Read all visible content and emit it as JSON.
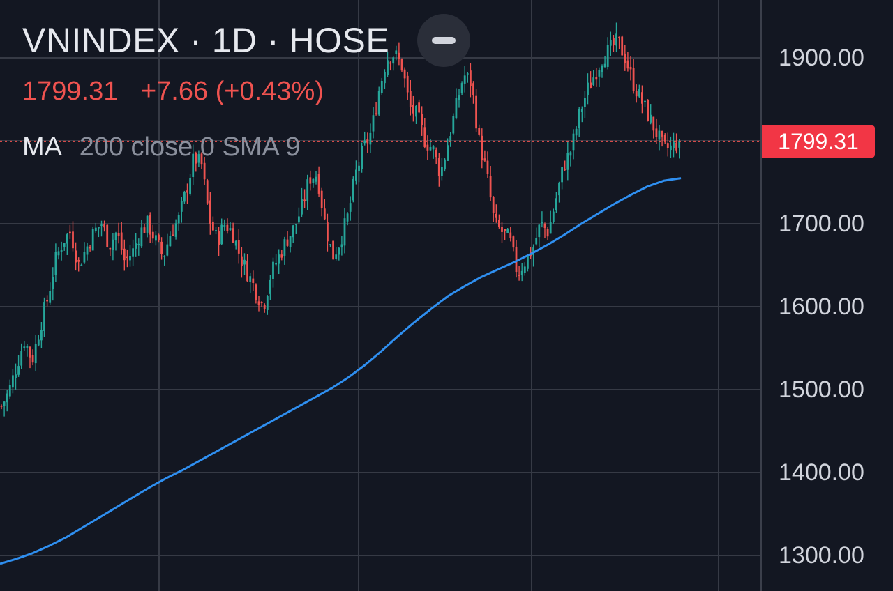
{
  "legend": {
    "title": "VNINDEX · 1D · HOSE",
    "last_price": "1799.31",
    "change": "+7.66 (+0.43%)",
    "ma_name": "MA",
    "ma_params": "200 close 0 SMA 9"
  },
  "controls": {
    "collapse_icon": "minus-icon"
  },
  "colors": {
    "background": "#131722",
    "grid": "#363a45",
    "up": "#26a69a",
    "down": "#ef5350",
    "ma_line": "#2f8ff0",
    "last_price_tag": "#f23645"
  },
  "price_scale": {
    "ticks": [
      "1900.00",
      "1800.00",
      "1700.00",
      "1600.00",
      "1500.00",
      "1400.00",
      "1300.00"
    ],
    "last_price_label": "1799.31"
  },
  "chart_data": {
    "type": "candlestick",
    "symbol": "VNINDEX",
    "interval": "1D",
    "exchange": "HOSE",
    "y_range": [
      1280,
      1935
    ],
    "last_close": 1799.31,
    "grid": true,
    "close_series": [
      1480,
      1498,
      1530,
      1560,
      1535,
      1575,
      1610,
      1655,
      1680,
      1690,
      1650,
      1670,
      1690,
      1700,
      1675,
      1690,
      1655,
      1665,
      1690,
      1700,
      1680,
      1660,
      1690,
      1705,
      1740,
      1780,
      1770,
      1705,
      1680,
      1700,
      1690,
      1660,
      1640,
      1620,
      1600,
      1640,
      1660,
      1680,
      1695,
      1720,
      1755,
      1760,
      1700,
      1660,
      1680,
      1710,
      1760,
      1790,
      1810,
      1860,
      1900,
      1905,
      1890,
      1840,
      1830,
      1800,
      1790,
      1760,
      1800,
      1840,
      1880,
      1870,
      1800,
      1760,
      1700,
      1690,
      1680,
      1640,
      1655,
      1670,
      1700,
      1690,
      1730,
      1770,
      1790,
      1830,
      1860,
      1880,
      1900,
      1910,
      1920,
      1900,
      1870,
      1850,
      1830,
      1810,
      1790,
      1791.65,
      1799.31
    ],
    "ma_series": {
      "name": "MA 200",
      "values": [
        1290,
        1296,
        1303,
        1312,
        1322,
        1334,
        1346,
        1358,
        1370,
        1382,
        1393,
        1403,
        1414,
        1425,
        1436,
        1447,
        1458,
        1469,
        1480,
        1491,
        1502,
        1515,
        1530,
        1547,
        1565,
        1582,
        1598,
        1613,
        1625,
        1636,
        1645,
        1654,
        1664,
        1675,
        1687,
        1700,
        1712,
        1724,
        1735,
        1745,
        1752,
        1755
      ]
    }
  }
}
